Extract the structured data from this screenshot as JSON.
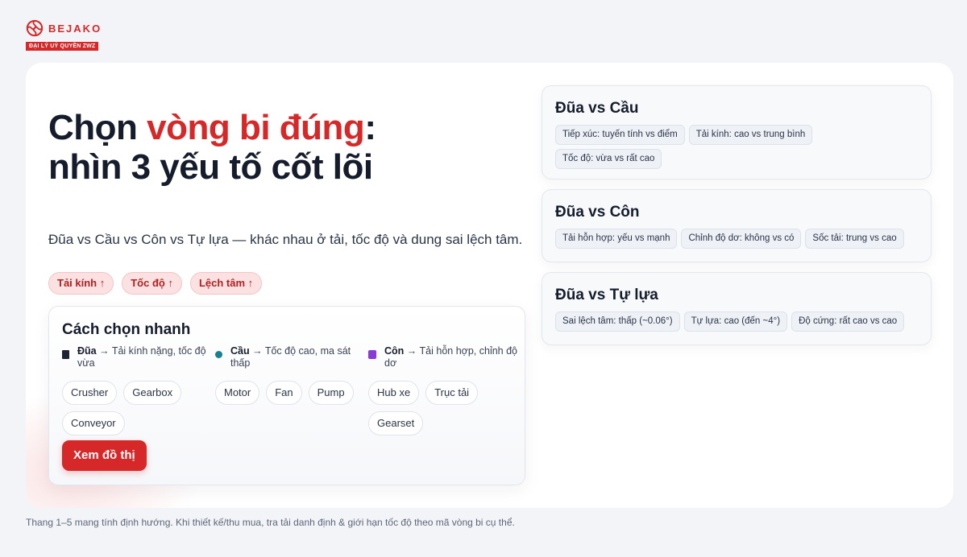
{
  "brand": {
    "name": "BEJAKO",
    "tagline": "ĐẠI LÝ UỶ QUYỀN ZWZ",
    "icon": "bejako-logo-icon",
    "color": "#d62828"
  },
  "hero": {
    "title_prefix": "Chọn ",
    "title_highlight": "vòng bi đúng",
    "title_suffix": ":",
    "title_line2": "nhìn 3 yếu tố cốt lõi",
    "subtitle": "Đũa vs Cầu vs Côn vs Tự lựa — khác nhau ở tải, tốc độ và dung sai lệch tâm.",
    "chips": [
      "Tải kính ↑",
      "Tốc độ ↑",
      "Lệch tâm ↑"
    ]
  },
  "quick": {
    "title": "Cách chọn nhanh",
    "columns": [
      {
        "name": "Đũa",
        "desc": " → Tải kính nặng, tốc độ vừa",
        "marker": "square",
        "tags": [
          "Crusher",
          "Gearbox",
          "Conveyor"
        ]
      },
      {
        "name": "Cầu",
        "desc": " → Tốc độ cao, ma sát thấp",
        "marker": "dot",
        "tags": [
          "Motor",
          "Fan",
          "Pump"
        ]
      },
      {
        "name": "Côn",
        "desc": " → Tải hỗn hợp, chỉnh độ dơ",
        "marker": "purple",
        "tags": [
          "Hub xe",
          "Trục tải",
          "Gearset"
        ]
      }
    ],
    "cta": "Xem đồ thị"
  },
  "compare": [
    {
      "title": "Đũa vs Cầu",
      "tags": [
        "Tiếp xúc: tuyến tính vs điểm",
        "Tải kính: cao vs trung bình",
        "Tốc độ: vừa vs rất cao"
      ]
    },
    {
      "title": "Đũa vs Côn",
      "tags": [
        "Tải hỗn hợp: yếu vs mạnh",
        "Chỉnh độ dơ: không vs có",
        "Sốc tải: trung vs cao"
      ]
    },
    {
      "title": "Đũa vs Tự lựa",
      "tags": [
        "Sai lệch tâm: thấp (~0.06°)",
        "Tự lựa: cao (đến ~4°)",
        "Độ cứng: rất cao vs cao"
      ]
    }
  ],
  "footnote": "Thang 1–5 mang tính định hướng. Khi thiết kế/thu mua, tra tải danh định & giới hạn tốc độ theo mã vòng bi cụ thể."
}
